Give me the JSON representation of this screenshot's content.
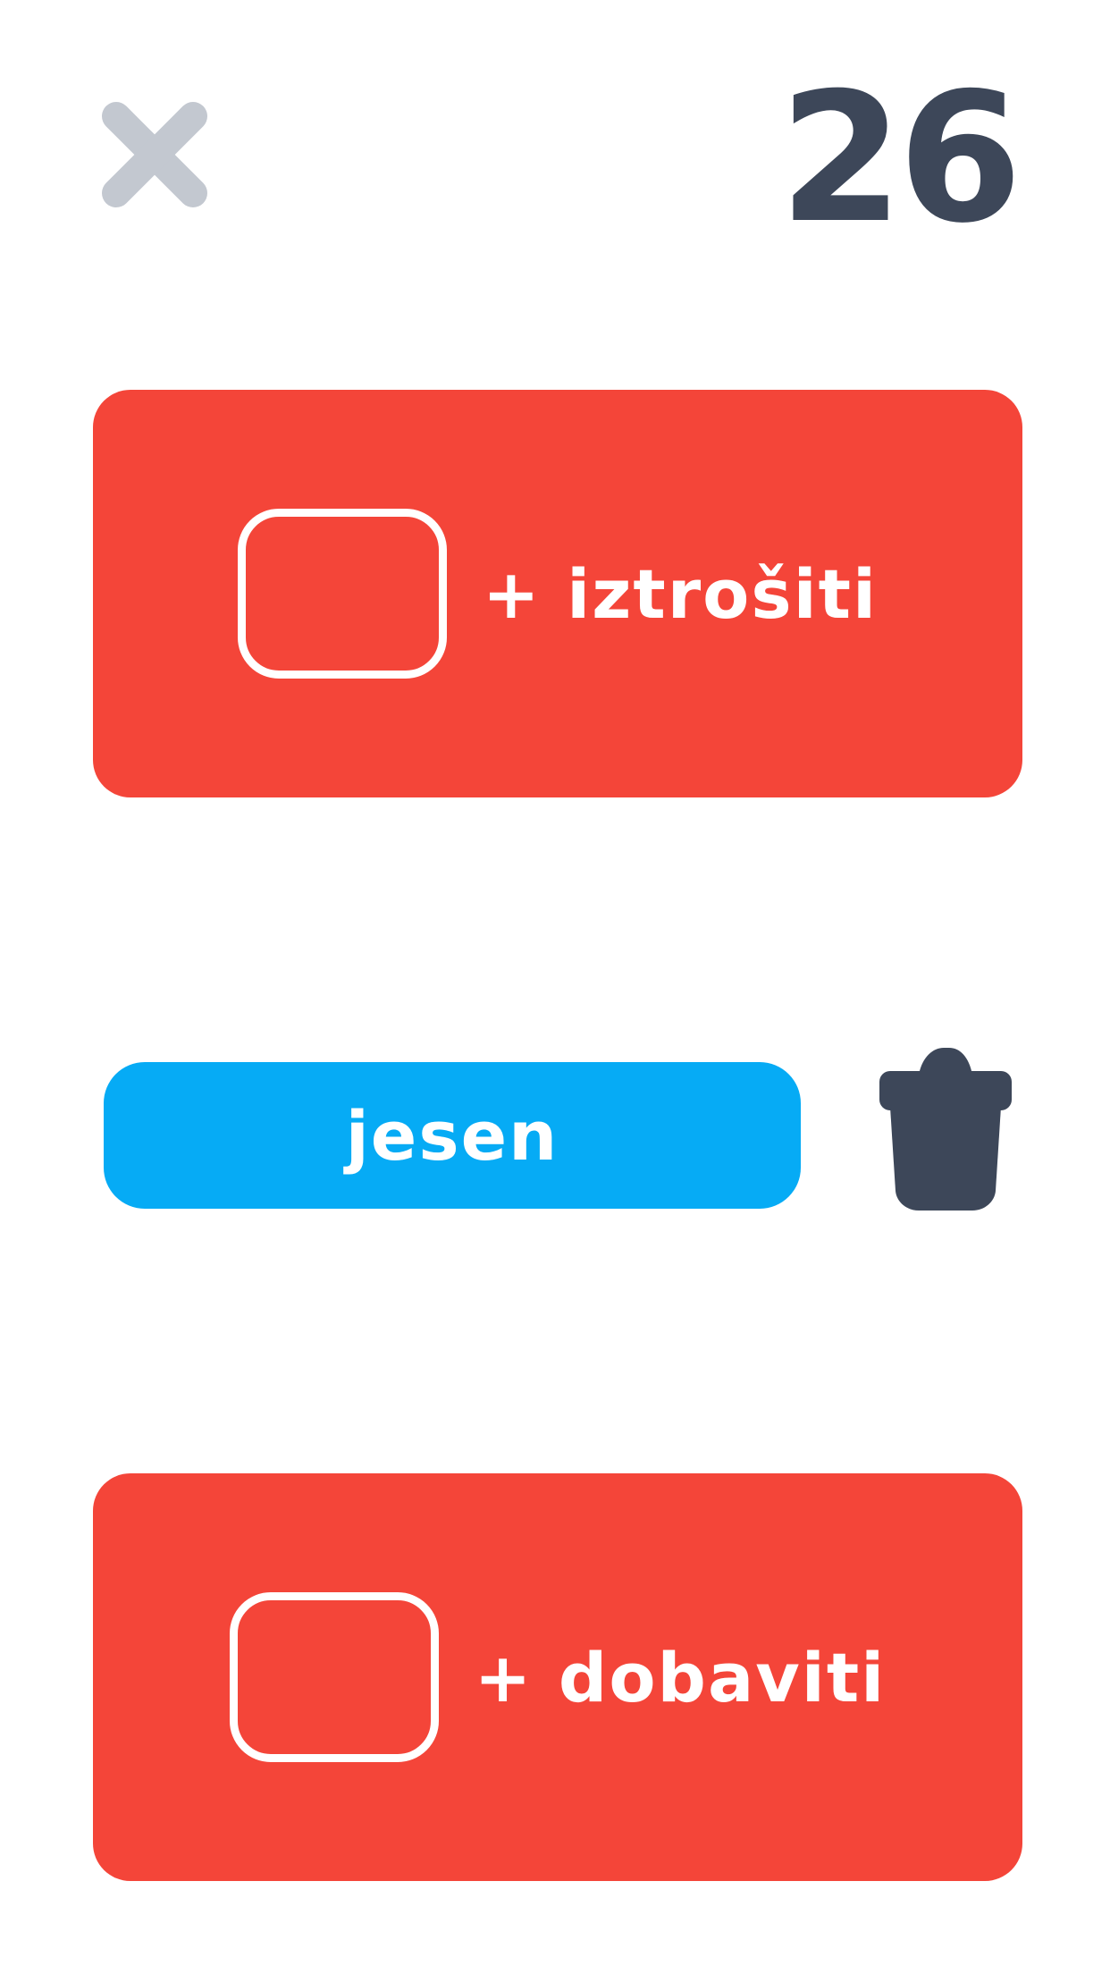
{
  "header": {
    "close_icon": "close-x-icon",
    "counter": "26"
  },
  "cards": [
    {
      "blank": "",
      "label": "+ iztrošiti"
    },
    {
      "blank": "",
      "label": "+ dobaviti"
    }
  ],
  "word_chip": {
    "label": "jesen"
  },
  "trash_icon": "trash-icon",
  "colors": {
    "card_red": "#f44539",
    "chip_blue": "#06abf5",
    "counter_dark": "#3d4759",
    "close_gray": "#c3c8d0"
  }
}
